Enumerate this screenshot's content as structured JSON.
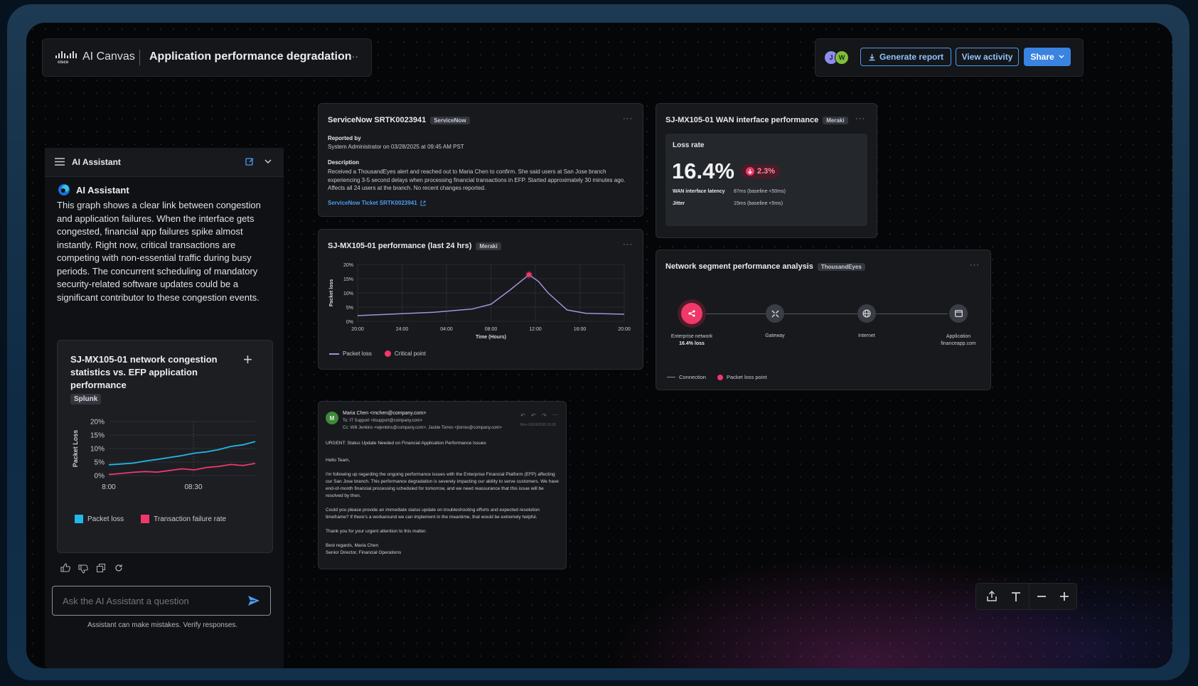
{
  "header": {
    "brand": "AI Canvas",
    "title": "Application performance degradation",
    "more": "···",
    "avatars": [
      "J",
      "W"
    ],
    "generate_report": "Generate report",
    "view_activity": "View activity",
    "share": "Share"
  },
  "assistant": {
    "panel_title": "AI Assistant",
    "name": "AI Assistant",
    "message": "This graph shows a clear link between congestion and application failures. When the interface gets congested, financial app failures spike almost instantly. Right now, critical transactions are competing with non-essential traffic during busy periods. The concurrent scheduling of mandatory security-related software updates could be a significant contributor to these congestion events.",
    "input_placeholder": "Ask the AI Assistant a question",
    "disclaimer": "Assistant can make mistakes. Verify responses."
  },
  "splunk_card": {
    "title": "SJ-MX105-01 network congestion statistics vs. EFP application performance",
    "tag": "Splunk",
    "plus": "+"
  },
  "servicenow": {
    "title": "ServiceNow SRTK0023941",
    "tag": "ServiceNow",
    "reported_by_label": "Reported by",
    "reported_by": "System Administrator on 03/28/2025 at 09:45 AM PST",
    "description_label": "Description",
    "description": "Received a ThousandEyes alert and reached out to Maria Chen to confirm. She said users at San Jose branch experiencing 3-5 second delays when processing financial transactions in EFP. Started approximately 30 minutes ago. Affects all 24 users at the branch. No recent changes reported.",
    "link": "ServiceNow Ticket SRTK0023941"
  },
  "wan": {
    "title": "SJ-MX105-01 WAN interface performance",
    "tag": "Meraki",
    "loss_label": "Loss rate",
    "loss_value": "16.4%",
    "delta": "2.3%",
    "latency_label": "WAN interface latency",
    "latency_value": "87ms (baseline <50ms)",
    "jitter_label": "Jitter",
    "jitter_value": "15ms (baseline <5ms)"
  },
  "perf": {
    "title": "SJ-MX105-01 performance (last 24 hrs)",
    "tag": "Meraki",
    "legend_line": "Packet loss",
    "legend_point": "Critical point"
  },
  "segment": {
    "title": "Network segment performance analysis",
    "tag": "ThousandEyes",
    "nodes": [
      {
        "label": "Enterprise network",
        "sub": "16.4% loss"
      },
      {
        "label": "Gateway",
        "sub": ""
      },
      {
        "label": "Internet",
        "sub": ""
      },
      {
        "label": "Application",
        "sub": "financeapp.com"
      }
    ],
    "legend_connection": "Connection",
    "legend_point": "Packet loss point"
  },
  "email": {
    "avatar": "M",
    "from": "Maria Chen <mchen@company.com>",
    "to": "To: IT Support <itsupport@company.com>",
    "cc": "Cc: Will Jenkins <wjenkins@company.com>; Jackie Torres <jtorres@company.com>",
    "date": "Mon 03/24/2025 10:26",
    "subject": "URGENT: Status Update Needed on Financial Application Performance Issues",
    "greeting": "Hello Team,",
    "p1": "I'm following up regarding the ongoing performance issues with the Enterprise Financial Platform (EFP) affecting our San Jose branch. This performance degradation is severely impacting our ability to serve customers. We have end-of-month financial processing scheduled for tomorrow, and we need reassurance that this issue will be resolved by then.",
    "p2": "Could you please provide an immediate status update on troubleshooting efforts and expected resolution timeframe? If there's a workaround we can implement in the meantime, that would be extremely helpful.",
    "p3": "Thank you for your urgent attention to this matter.",
    "sign1": "Best regards, Maria Chen",
    "sign2": "Senior Director, Financial Operations"
  },
  "chart_data": [
    {
      "type": "line",
      "title": "SJ-MX105-01 network congestion statistics vs. EFP application performance",
      "ylabel": "Packet Loss",
      "xlabel": "",
      "x_ticks": [
        "8:00",
        "08:30"
      ],
      "y_ticks": [
        "20%",
        "15%",
        "10%",
        "5%",
        "0%"
      ],
      "ylim": [
        0,
        20
      ],
      "grid": true,
      "legend": "bottom",
      "series": [
        {
          "name": "Packet loss",
          "color": "#22b7e8",
          "values": [
            4.0,
            4.3,
            4.6,
            5.4,
            6.0,
            6.7,
            7.4,
            8.3,
            8.8,
            9.6,
            10.8,
            11.4,
            12.6
          ]
        },
        {
          "name": "Transaction failure rate",
          "color": "#f0386b",
          "values": [
            0.4,
            0.8,
            1.2,
            1.5,
            1.3,
            1.9,
            2.5,
            2.1,
            3.0,
            3.4,
            4.1,
            3.7,
            4.5
          ]
        }
      ]
    },
    {
      "type": "line",
      "title": "SJ-MX105-01 performance (last 24 hrs)",
      "ylabel": "Packet loss",
      "xlabel": "Time (Hours)",
      "x_ticks": [
        "20:00",
        "24:00",
        "04:00",
        "08:00",
        "12:00",
        "16:00",
        "20:00"
      ],
      "y_ticks": [
        "20%",
        "15%",
        "10%",
        "5%",
        "0%"
      ],
      "ylim": [
        0,
        20
      ],
      "grid": true,
      "legend": "bottom-left",
      "series": [
        {
          "name": "Packet loss",
          "color": "#a88fd8",
          "x": [
            20,
            24,
            28,
            32,
            34,
            36,
            38,
            39,
            40,
            42,
            44,
            48
          ],
          "values": [
            2.0,
            2.6,
            3.2,
            4.3,
            6.0,
            11.0,
            16.4,
            14.0,
            10.0,
            4.0,
            2.8,
            2.5
          ]
        }
      ],
      "critical_point": {
        "x": 38,
        "value": 16.4
      }
    }
  ]
}
